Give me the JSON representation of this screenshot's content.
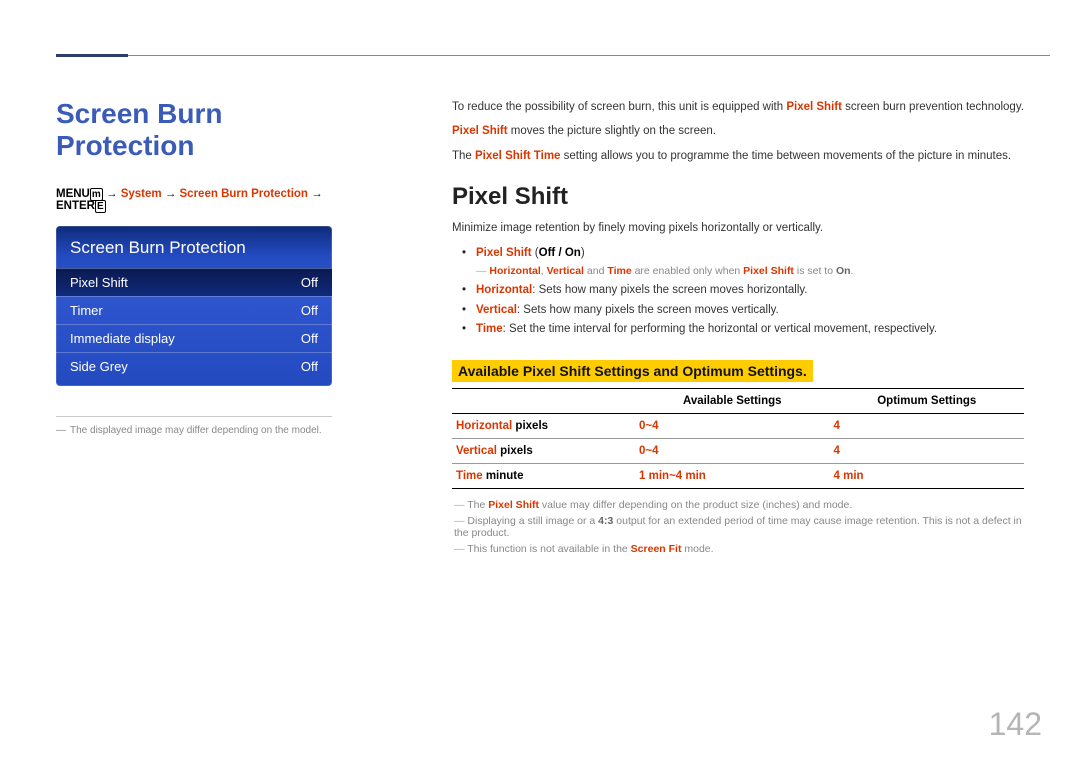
{
  "page_number": "142",
  "main_title": "Screen Burn Protection",
  "breadcrumbs": {
    "menu": "MENU",
    "p1": "System",
    "p2": "Screen Burn Protection",
    "enter": "ENTER"
  },
  "osd": {
    "title": "Screen Burn Protection",
    "rows": [
      {
        "label": "Pixel Shift",
        "value": "Off",
        "selected": true
      },
      {
        "label": "Timer",
        "value": "Off",
        "selected": false
      },
      {
        "label": "Immediate display",
        "value": "Off",
        "selected": false
      },
      {
        "label": "Side Grey",
        "value": "Off",
        "selected": false
      }
    ]
  },
  "left_note": "The displayed image may differ depending on the model.",
  "intro": {
    "p1_pre": "To reduce the possibility of screen burn, this unit is equipped with ",
    "p1_red": "Pixel Shift",
    "p1_post": " screen burn prevention technology.",
    "p2_red": "Pixel Shift",
    "p2_post": " moves the picture slightly on the screen.",
    "p3_pre": "The ",
    "p3_red": "Pixel Shift Time",
    "p3_post": " setting allows you to programme the time between movements of the picture in minutes."
  },
  "pixel_shift": {
    "title": "Pixel Shift",
    "desc": "Minimize image retention by finely moving pixels horizontally or vertically.",
    "item_label": "Pixel Shift",
    "item_options": "Off / On",
    "enable_note_pre": "",
    "enable_note": {
      "h": "Horizontal",
      "v": "Vertical",
      "t": "Time",
      "mid": " are enabled only when ",
      "ps": "Pixel Shift",
      "end": " is set to ",
      "on": "On"
    },
    "bullets": {
      "h_label": "Horizontal",
      "h_desc": ": Sets how many pixels the screen moves horizontally.",
      "v_label": "Vertical",
      "v_desc": ": Sets how many pixels the screen moves vertically.",
      "t_label": "Time",
      "t_desc": ": Set the time interval for performing the horizontal or vertical movement, respectively."
    }
  },
  "table": {
    "heading": "Available Pixel Shift Settings and Optimum Settings.",
    "col2": "Available Settings",
    "col3": "Optimum Settings",
    "rows": [
      {
        "label_red": "Horizontal",
        "label_black": " pixels",
        "avail": "0~4",
        "opt": "4"
      },
      {
        "label_red": "Vertical",
        "label_black": " pixels",
        "avail": "0~4",
        "opt": "4"
      },
      {
        "label_red": "Time",
        "label_black": " minute",
        "avail": "1 min~4 min",
        "opt": "4 min"
      }
    ]
  },
  "footer_notes": {
    "n1_pre": "The ",
    "n1_red": "Pixel Shift",
    "n1_post": " value may differ depending on the product size (inches) and mode.",
    "n2_pre": "Displaying a still image or a ",
    "n2_bold": "4:3",
    "n2_post": " output for an extended period of time may cause image retention. This is not a defect in the product.",
    "n3_pre": "This function is not available in the ",
    "n3_red": "Screen Fit",
    "n3_post": " mode."
  }
}
